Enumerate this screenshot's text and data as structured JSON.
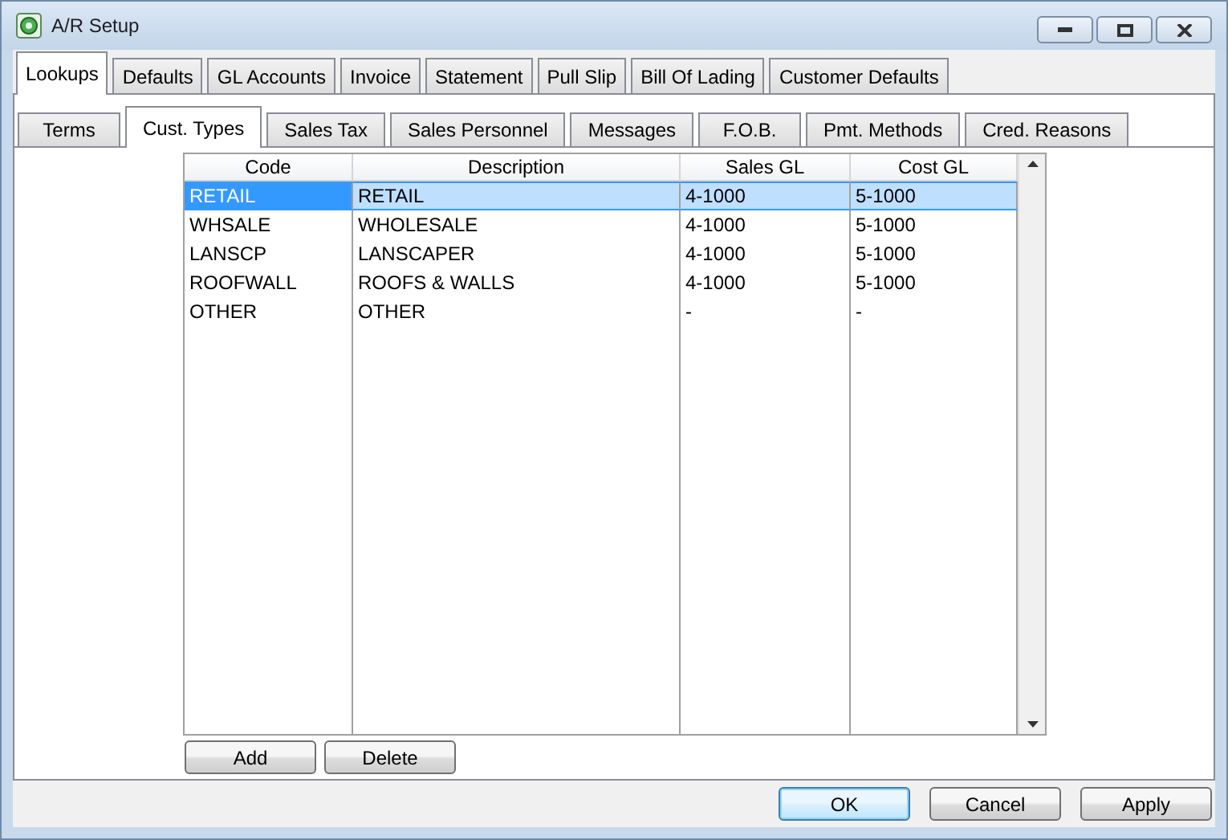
{
  "window": {
    "title": "A/R Setup"
  },
  "tabs": [
    {
      "label": "Lookups",
      "selected": true
    },
    {
      "label": "Defaults",
      "selected": false
    },
    {
      "label": "GL Accounts",
      "selected": false
    },
    {
      "label": "Invoice",
      "selected": false
    },
    {
      "label": "Statement",
      "selected": false
    },
    {
      "label": "Pull Slip",
      "selected": false
    },
    {
      "label": "Bill Of Lading",
      "selected": false
    },
    {
      "label": "Customer Defaults",
      "selected": false
    }
  ],
  "sub_tabs": [
    {
      "label": "Terms",
      "selected": false
    },
    {
      "label": "Cust. Types",
      "selected": true
    },
    {
      "label": "Sales Tax",
      "selected": false
    },
    {
      "label": "Sales Personnel",
      "selected": false
    },
    {
      "label": "Messages",
      "selected": false
    },
    {
      "label": "F.O.B.",
      "selected": false
    },
    {
      "label": "Pmt. Methods",
      "selected": false
    },
    {
      "label": "Cred. Reasons",
      "selected": false
    }
  ],
  "table": {
    "columns": [
      "Code",
      "Description",
      "Sales GL",
      "Cost GL"
    ],
    "rows": [
      {
        "cells": [
          "RETAIL",
          "RETAIL",
          "4-1000",
          "5-1000"
        ],
        "selected": true
      },
      {
        "cells": [
          "WHSALE",
          "WHOLESALE",
          "4-1000",
          "5-1000"
        ],
        "selected": false
      },
      {
        "cells": [
          "LANSCP",
          "LANSCAPER",
          "4-1000",
          "5-1000"
        ],
        "selected": false
      },
      {
        "cells": [
          "ROOFWALL",
          "ROOFS & WALLS",
          "4-1000",
          "5-1000"
        ],
        "selected": false
      },
      {
        "cells": [
          "OTHER",
          "OTHER",
          "-",
          "-"
        ],
        "selected": false
      }
    ]
  },
  "table_buttons": [
    "Add",
    "Delete"
  ],
  "dialog_buttons": [
    {
      "label": "OK",
      "default": true
    },
    {
      "label": "Cancel",
      "default": false
    },
    {
      "label": "Apply",
      "default": false
    }
  ]
}
